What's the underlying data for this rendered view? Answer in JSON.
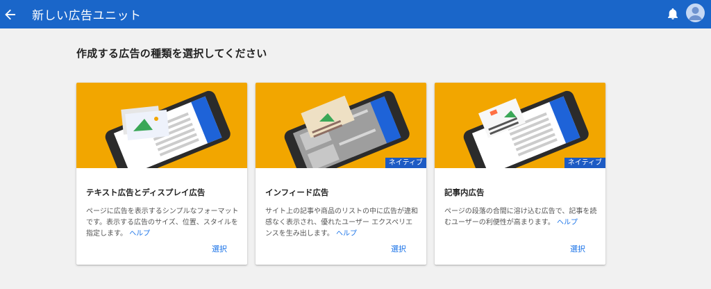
{
  "header": {
    "title": "新しい広告ユニット",
    "back_icon": "arrow-back-icon",
    "bell_icon": "bell-icon",
    "avatar_icon": "account-circle-icon",
    "color": "#1a66c9"
  },
  "main": {
    "heading": "作成する広告の種類を選択してください"
  },
  "cards": [
    {
      "title": "テキスト広告とディスプレイ広告",
      "desc": "ページに広告を表示するシンプルなフォーマットです。表示する広告のサイズ、位置、スタイルを指定します。",
      "help": "ヘルプ",
      "badge": "",
      "select": "選択"
    },
    {
      "title": "インフィード広告",
      "desc": "サイト上の記事や商品のリストの中に広告が違和感なく表示され、優れたユーザー エクスペリエンスを生み出します。",
      "help": "ヘルプ",
      "badge": "ネイティブ",
      "select": "選択"
    },
    {
      "title": "記事内広告",
      "desc": "ページの段落の合間に溶け込む広告で、記事を読むユーザーの利便性が高まります。",
      "help": "ヘルプ",
      "badge": "ネイティブ",
      "select": "選択"
    }
  ],
  "colors": {
    "illustration_bg": "#f2a600",
    "badge_bg": "#1d5bc4",
    "link": "#1a73e8"
  }
}
